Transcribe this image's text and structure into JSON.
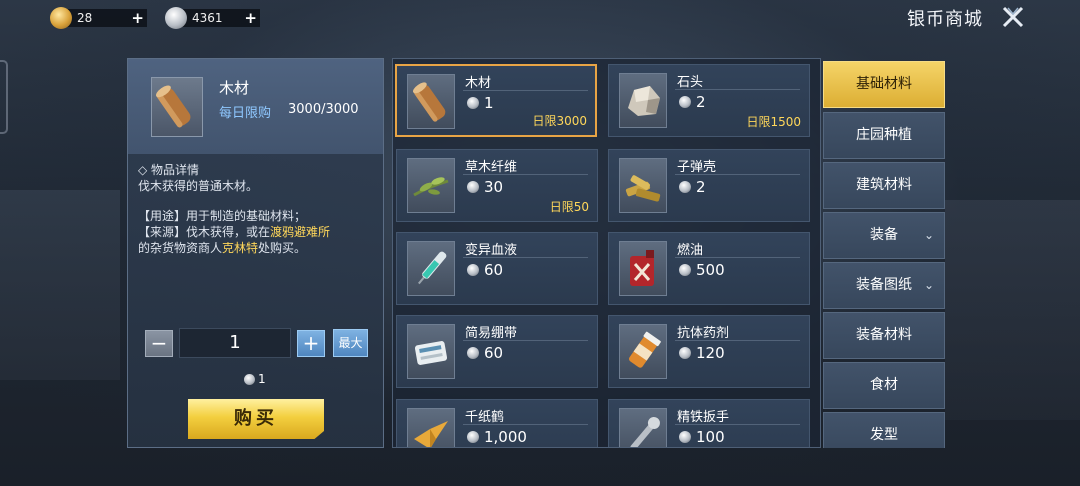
{
  "currency": {
    "gold": {
      "amount": "28",
      "add": "+"
    },
    "silver": {
      "amount": "4361",
      "add": "+"
    }
  },
  "header": {
    "title": "银币商城"
  },
  "detail": {
    "name": "木材",
    "limit_label": "每日限购",
    "limit_value": "3000/3000",
    "desc_title": "◇ 物品详情",
    "desc_line1": "伐木获得的普通木材。",
    "use_line": "【用途】用于制造的基础材料；",
    "source_prefix": "【来源】伐木获得，或在",
    "source_place": "渡鸦避难所",
    "source_mid": "的杂货物资商人",
    "source_npc": "克林特",
    "source_suffix": "处购买。",
    "quantity": "1",
    "minus": "−",
    "plus": "+",
    "max": "最大",
    "cost": "1",
    "buy": "购买"
  },
  "items": [
    {
      "name": "木材",
      "price": "1",
      "limit": "日限3000",
      "icon": "wood-icon"
    },
    {
      "name": "石头",
      "price": "2",
      "limit": "日限1500",
      "icon": "stone-icon"
    },
    {
      "name": "草木纤维",
      "price": "30",
      "limit": "日限50",
      "icon": "fiber-icon"
    },
    {
      "name": "子弹壳",
      "price": "2",
      "limit": "",
      "icon": "bullet-shell-icon"
    },
    {
      "name": "变异血液",
      "price": "60",
      "limit": "",
      "icon": "syringe-icon"
    },
    {
      "name": "燃油",
      "price": "500",
      "limit": "",
      "icon": "fuel-can-icon"
    },
    {
      "name": "简易绷带",
      "price": "60",
      "limit": "",
      "icon": "bandage-icon"
    },
    {
      "name": "抗体药剂",
      "price": "120",
      "limit": "",
      "icon": "pill-bottle-icon"
    },
    {
      "name": "千纸鹤",
      "price": "1,000",
      "limit": "",
      "icon": "paper-crane-icon"
    },
    {
      "name": "精铁扳手",
      "price": "100",
      "limit": "",
      "icon": "wrench-icon"
    }
  ],
  "tabs": [
    {
      "label": "基础材料",
      "active": true
    },
    {
      "label": "庄园种植"
    },
    {
      "label": "建筑材料"
    },
    {
      "label": "装备",
      "chevron": "⌄"
    },
    {
      "label": "装备图纸",
      "chevron": "⌄"
    },
    {
      "label": "装备材料"
    },
    {
      "label": "食材"
    },
    {
      "label": "发型"
    }
  ]
}
